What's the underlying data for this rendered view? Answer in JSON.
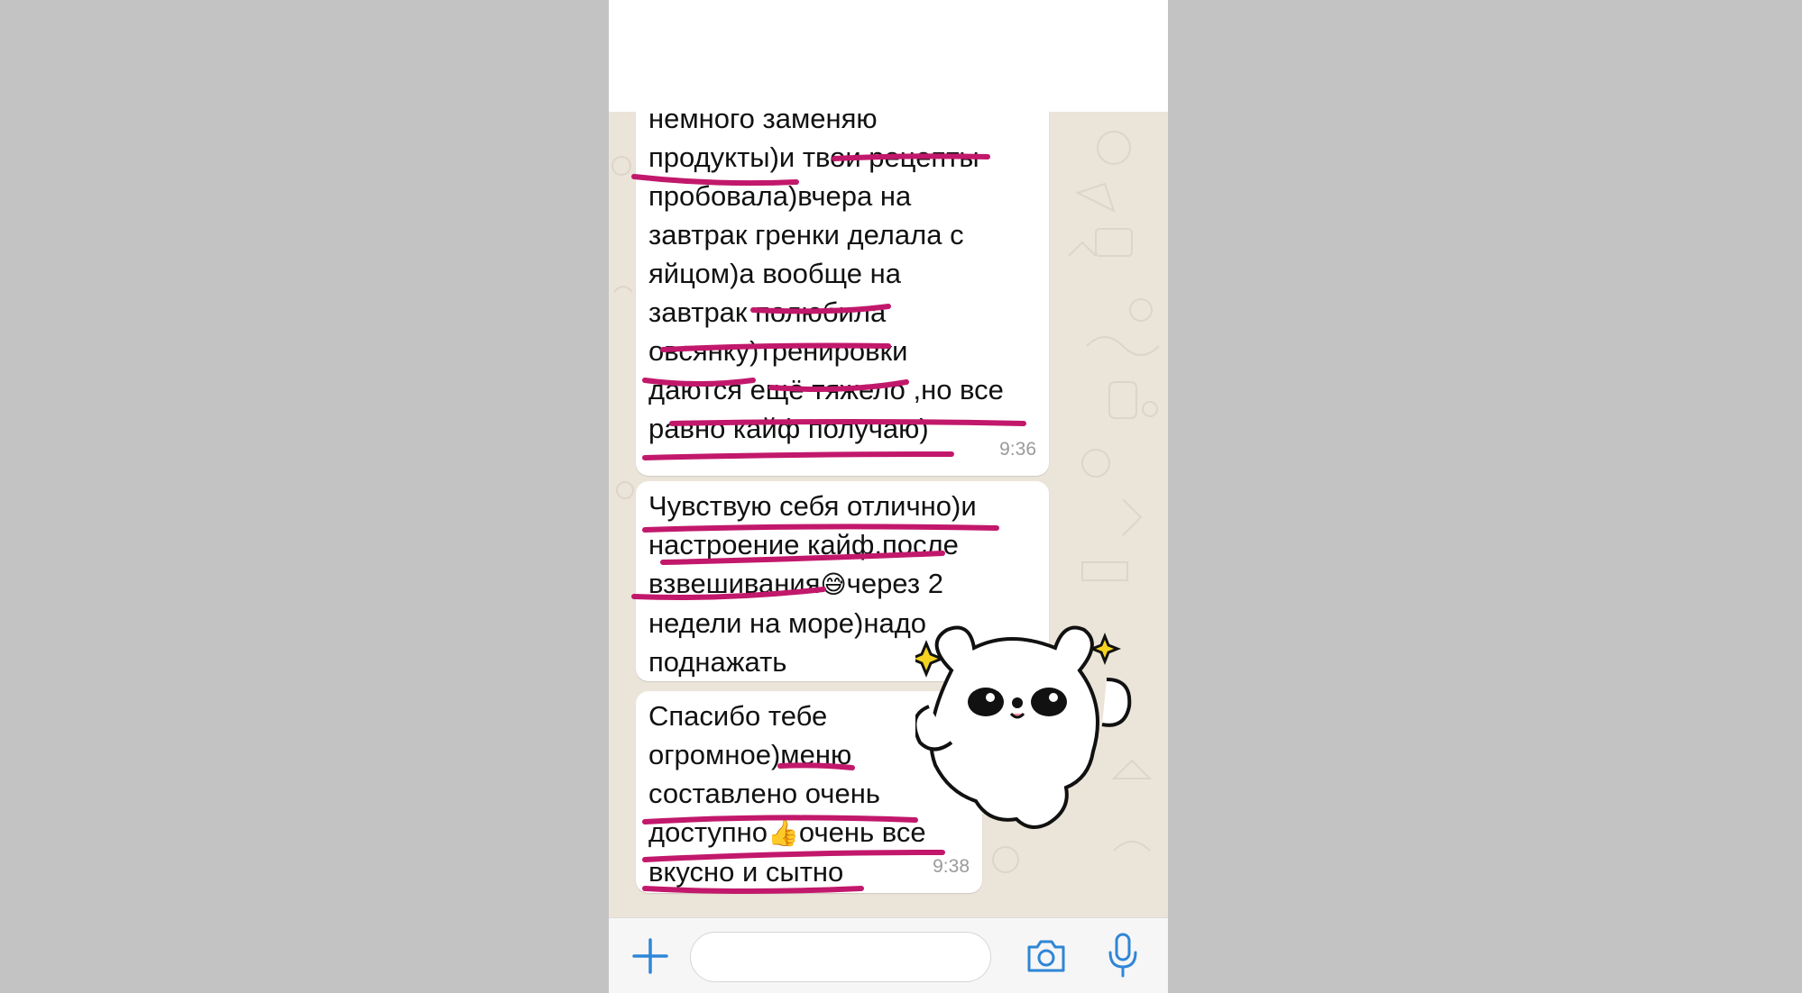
{
  "messages": [
    {
      "lines": [
        "немного заменяю",
        "продукты)и твои рецепты",
        "пробовала)вчера на",
        "завтрак гренки делала с",
        "яйцом)а вообще на",
        "завтрак полюбила",
        "овсянку)тренировки",
        "даются ещё тяжело ,но все",
        "равно кайф получаю)"
      ],
      "time": "9:36"
    },
    {
      "lines": [
        "Чувствую себя отлично)и",
        "настроение кайф,после",
        "взвешивания",
        "через 2",
        "недели на море)надо",
        "поднажать"
      ],
      "emoji": "😅"
    },
    {
      "lines": [
        "Спасибо тебе",
        "огромное)меню",
        "составлено очень",
        "доступно",
        "очень все",
        "вкусно и сытно"
      ],
      "emoji": "👍",
      "time": "9:38"
    }
  ],
  "input": {
    "placeholder": ""
  },
  "icons": {
    "attach": "plus-icon",
    "camera": "camera-icon",
    "mic": "microphone-icon",
    "sticker": "bear-sticker"
  },
  "colors": {
    "accent": "#2f86d6",
    "underline": "#c2186b",
    "bubble": "#ffffff",
    "wallpaper": "#ebe4d9"
  }
}
